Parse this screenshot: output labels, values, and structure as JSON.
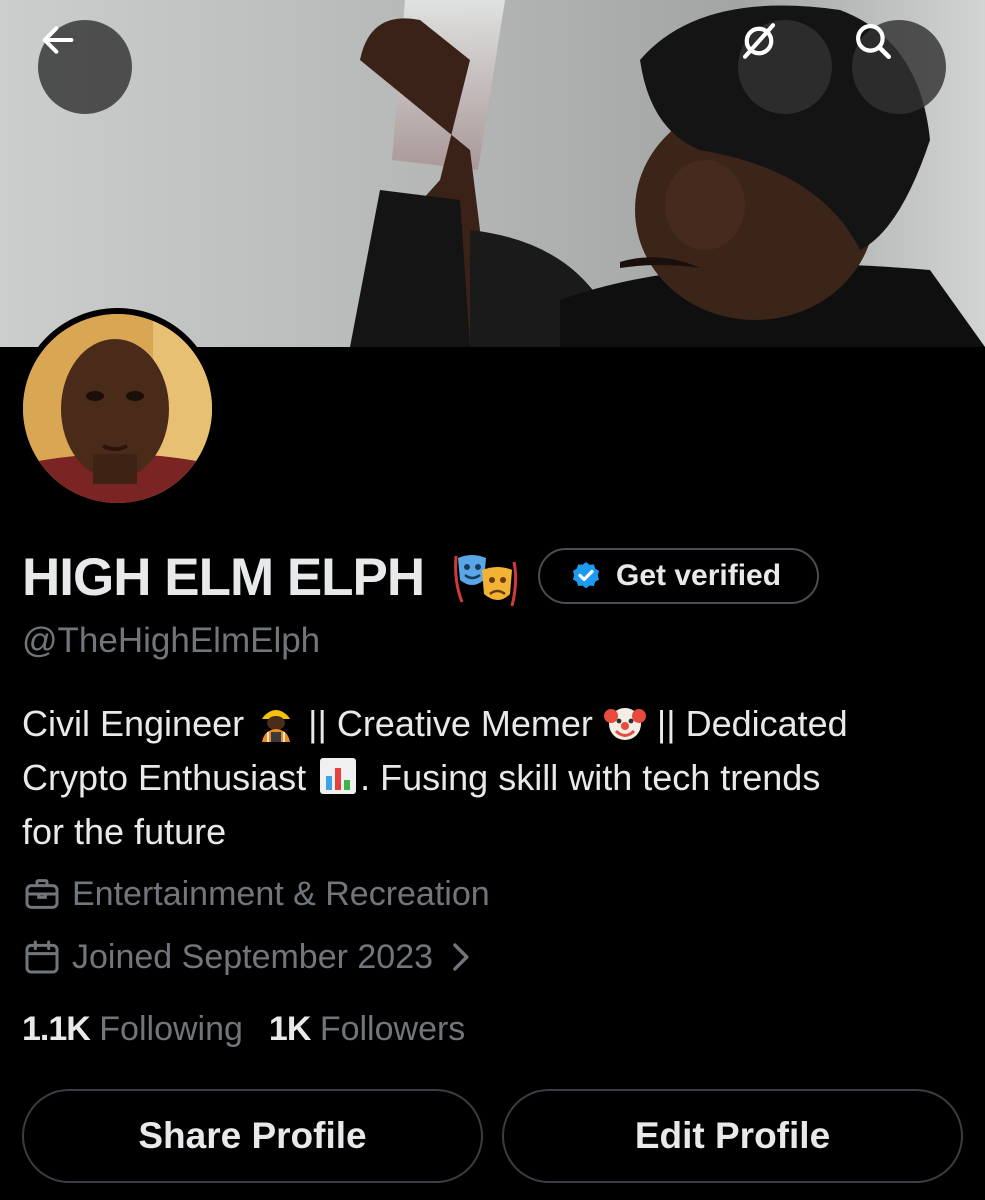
{
  "profile": {
    "display_name": "HIGH ELM ELPH",
    "name_emoji": "performing-arts-emoji",
    "handle": "@TheHighElmElph",
    "get_verified_label": "Get verified",
    "bio": {
      "part1": "Civil Engineer ",
      "part2": " || Creative Memer ",
      "part3": " || Dedicated",
      "part4": "Crypto Enthusiast ",
      "part5": ". Fusing skill with tech trends",
      "part6": "for the future"
    },
    "category": "Entertainment & Recreation",
    "joined": "Joined September 2023",
    "following_count": "1.1K",
    "following_label": "Following",
    "followers_count": "1K",
    "followers_label": "Followers"
  },
  "actions": {
    "share_label": "Share Profile",
    "edit_label": "Edit Profile"
  },
  "icons": {
    "back": "arrow-left-icon",
    "grok": "grok-icon",
    "search": "search-icon",
    "verified": "verified-badge-icon",
    "briefcase": "briefcase-icon",
    "calendar": "calendar-icon",
    "chevron": "chevron-right-icon"
  },
  "colors": {
    "background": "#000000",
    "primary_text": "#e7e9ea",
    "secondary_text": "#71767b",
    "verified_blue": "#1d9bf0",
    "button_border": "#3a3d41"
  }
}
